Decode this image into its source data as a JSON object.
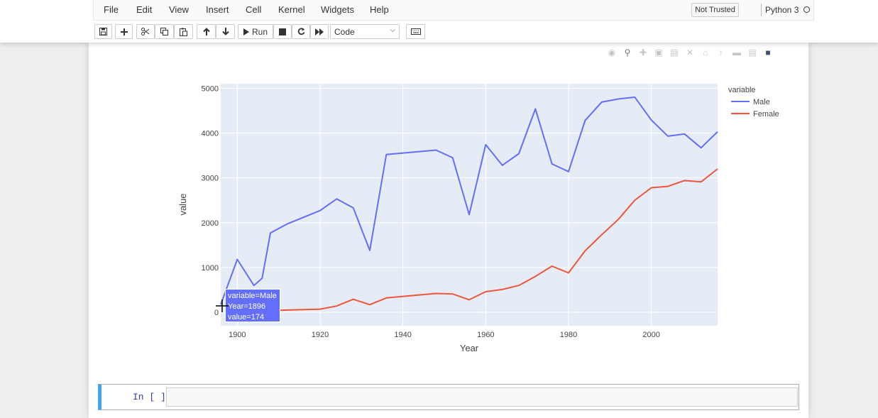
{
  "menu": [
    "File",
    "Edit",
    "View",
    "Insert",
    "Cell",
    "Kernel",
    "Widgets",
    "Help"
  ],
  "kernel": {
    "trusted_label": "Not Trusted",
    "name": "Python 3"
  },
  "toolbar": {
    "run_label": "Run",
    "cell_type": "Code",
    "buttons": [
      "save-icon",
      "plus-icon",
      "cut-icon",
      "copy-icon",
      "paste-icon",
      "arrow-up-icon",
      "arrow-down-icon",
      "run-icon",
      "stop-icon",
      "restart-icon",
      "fast-forward-icon",
      "keyboard-icon"
    ]
  },
  "modebar_icons": [
    "camera-icon",
    "zoom-icon",
    "pan-icon",
    "zoom-in-icon",
    "zoom-out-icon",
    "autoscale-icon",
    "reset-axes-icon",
    "spike-lines-icon",
    "hover-closest-icon",
    "hover-compare-icon",
    "plotly-logo-icon"
  ],
  "colors": {
    "male": "#636efa",
    "female": "#ef553b",
    "plot_bg": "#e5ecf6",
    "prompt": "#303f9f",
    "cell_border": "#42a5f5"
  },
  "chart_data": {
    "type": "line",
    "xlabel": "Year",
    "ylabel": "value",
    "xlim": [
      1896,
      2016
    ],
    "ylim": [
      -300,
      5100
    ],
    "xticks": [
      1900,
      1920,
      1940,
      1960,
      1980,
      2000
    ],
    "yticks": [
      0,
      1000,
      2000,
      3000,
      4000,
      5000
    ],
    "legend_title": "variable",
    "legend_position": "right",
    "grid": true,
    "series": [
      {
        "name": "Male",
        "color": "#636efa",
        "x": [
          1896,
          1900,
          1904,
          1906,
          1908,
          1912,
          1920,
          1924,
          1928,
          1932,
          1936,
          1948,
          1952,
          1956,
          1960,
          1964,
          1968,
          1972,
          1976,
          1980,
          1984,
          1988,
          1992,
          1996,
          2000,
          2004,
          2008,
          2012,
          2016
        ],
        "y": [
          174,
          1180,
          600,
          760,
          1770,
          1970,
          2270,
          2530,
          2330,
          1380,
          3520,
          3620,
          3450,
          2180,
          3740,
          3280,
          3540,
          4540,
          3310,
          3140,
          4280,
          4690,
          4760,
          4800,
          4290,
          3930,
          3980,
          3670,
          4030
        ]
      },
      {
        "name": "Female",
        "color": "#ef553b",
        "x": [
          1900,
          1904,
          1908,
          1912,
          1920,
          1924,
          1928,
          1932,
          1936,
          1948,
          1952,
          1956,
          1960,
          1964,
          1968,
          1972,
          1976,
          1980,
          1984,
          1988,
          1992,
          1996,
          2000,
          2004,
          2008,
          2012,
          2016
        ],
        "y": [
          20,
          10,
          40,
          50,
          70,
          140,
          290,
          170,
          320,
          420,
          410,
          280,
          460,
          510,
          600,
          800,
          1030,
          880,
          1370,
          1730,
          2070,
          2500,
          2780,
          2810,
          2940,
          2910,
          3200
        ]
      }
    ],
    "hover": {
      "variable": "variable=Male",
      "year": "Year=1896",
      "value": "value=174"
    }
  },
  "input_cell": {
    "prompt": "In [ ]:"
  }
}
